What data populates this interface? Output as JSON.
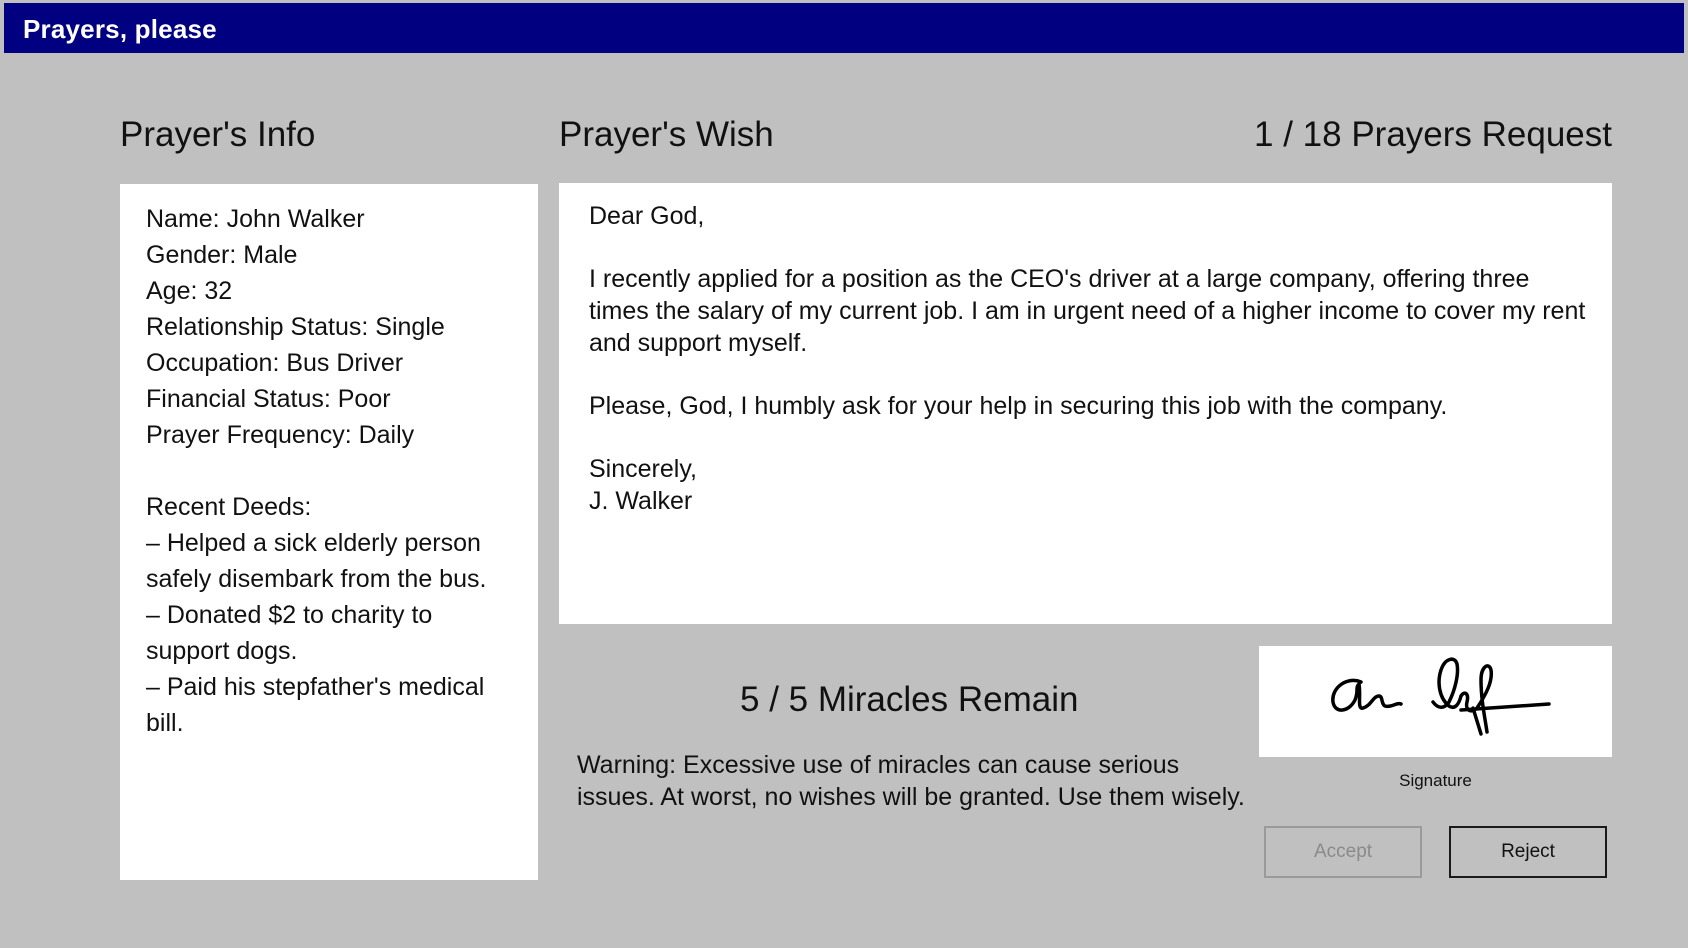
{
  "window": {
    "title": "Prayers, please"
  },
  "headings": {
    "info": "Prayer's Info",
    "wish": "Prayer's Wish",
    "request_count": "1 / 18  Prayers Request"
  },
  "prayer_info": {
    "lines": [
      "Name: John Walker",
      "Gender: Male",
      "Age: 32",
      "Relationship Status: Single",
      "Occupation: Bus Driver",
      "Financial Status: Poor",
      "Prayer Frequency: Daily"
    ],
    "deeds_heading": "Recent Deeds:",
    "deeds_lines": [
      "– Helped a sick elderly person",
      "safely disembark from the bus.",
      "– Donated $2 to charity to",
      "support dogs.",
      "– Paid his stepfather's medical",
      "bill."
    ]
  },
  "letter": {
    "greeting": "Dear God,",
    "body_1": "I recently applied for a position as the CEO's driver at a large company, offering three times the salary of my current job. I am in urgent need of a higher income to cover my rent and support myself.",
    "body_2": "Please, God, I humbly ask for your help in securing this job with the company.",
    "closing": "Sincerely,",
    "sender": "J. Walker"
  },
  "miracles": {
    "text": "5 / 5  Miracles Remain",
    "warning": "Warning: Excessive use of miracles can cause serious issues. At worst, no wishes will be granted. Use them wisely."
  },
  "signature": {
    "label": "Signature"
  },
  "buttons": {
    "accept": "Accept",
    "reject": "Reject"
  },
  "colors": {
    "titlebar": "#000080",
    "background": "#c0c0c0",
    "panel": "#ffffff"
  }
}
